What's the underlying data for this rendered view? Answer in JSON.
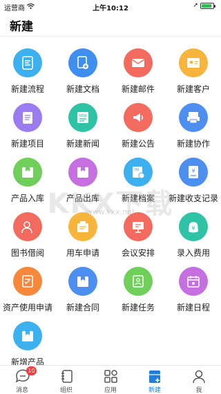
{
  "status_bar": {
    "carrier": "运营商",
    "time": "上午10:12",
    "battery_level": 0.9
  },
  "header": {
    "title": "新建"
  },
  "items": [
    {
      "label": "新建流程",
      "color": "#3db0f0",
      "icon": "flow-icon"
    },
    {
      "label": "新建文档",
      "color": "#3e8ef0",
      "icon": "document-icon"
    },
    {
      "label": "新建邮件",
      "color": "#f36a5e",
      "icon": "mail-icon"
    },
    {
      "label": "新建客户",
      "color": "#f7b53b",
      "icon": "customer-icon"
    },
    {
      "label": "新建项目",
      "color": "#9b7cf0",
      "icon": "project-icon"
    },
    {
      "label": "新建新闻",
      "color": "#2fc3a5",
      "icon": "news-icon"
    },
    {
      "label": "新建公告",
      "color": "#f36a5e",
      "icon": "announcement-icon"
    },
    {
      "label": "新建协作",
      "color": "#4d8ff0",
      "icon": "collaboration-icon"
    },
    {
      "label": "产品入库",
      "color": "#6fcf5a",
      "icon": "product-in-icon"
    },
    {
      "label": "产品出库",
      "color": "#c66fe0",
      "icon": "product-out-icon"
    },
    {
      "label": "新建档案",
      "color": "#3db0f0",
      "icon": "archive-icon"
    },
    {
      "label": "新建收支记录",
      "color": "#4d8ff0",
      "icon": "ledger-icon"
    },
    {
      "label": "图书借阅",
      "color": "#f36a5e",
      "icon": "book-borrow-icon"
    },
    {
      "label": "用车申请",
      "color": "#f7b53b",
      "icon": "car-request-icon"
    },
    {
      "label": "会议安排",
      "color": "#f36a5e",
      "icon": "meeting-icon"
    },
    {
      "label": "录入费用",
      "color": "#2fc3a5",
      "icon": "expense-icon"
    },
    {
      "label": "资产使用申请",
      "color": "#f7873b",
      "icon": "asset-icon"
    },
    {
      "label": "新建合同",
      "color": "#4d8ff0",
      "icon": "contract-icon"
    },
    {
      "label": "新建任务",
      "color": "#6fcf5a",
      "icon": "task-icon"
    },
    {
      "label": "新建日程",
      "color": "#c66fe0",
      "icon": "schedule-icon"
    },
    {
      "label": "新增产品",
      "color": "#3db0f0",
      "icon": "new-product-icon"
    }
  ],
  "watermark": {
    "text": "KKX下载",
    "url": "www.kkx.net"
  },
  "tabs": [
    {
      "label": "消息",
      "icon": "message-icon",
      "badge": "10",
      "active": false
    },
    {
      "label": "组织",
      "icon": "organization-icon",
      "active": false
    },
    {
      "label": "应用",
      "icon": "apps-icon",
      "active": false
    },
    {
      "label": "新建",
      "icon": "new-icon",
      "active": true
    },
    {
      "label": "我",
      "icon": "profile-icon",
      "active": false
    }
  ],
  "colors": {
    "accent": "#1e7fe0",
    "badge": "#f03c3c"
  }
}
